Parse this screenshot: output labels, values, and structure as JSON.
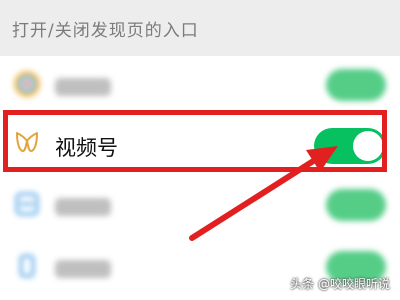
{
  "header": {
    "title": "打开/关闭发现页的入口"
  },
  "rows": [
    {
      "id": "moments",
      "blurred": true
    },
    {
      "id": "channels",
      "label": "视频号",
      "toggle_on": true
    },
    {
      "id": "scan",
      "blurred": true
    },
    {
      "id": "shake",
      "blurred": true
    }
  ],
  "colors": {
    "toggle_on": "#07c160",
    "highlight": "#e2201f",
    "channels_icon": "#e0a53c"
  },
  "icons": {
    "channels": "channels-butterfly-icon"
  },
  "watermark": {
    "text": "头条 @咬咬眼听说"
  }
}
